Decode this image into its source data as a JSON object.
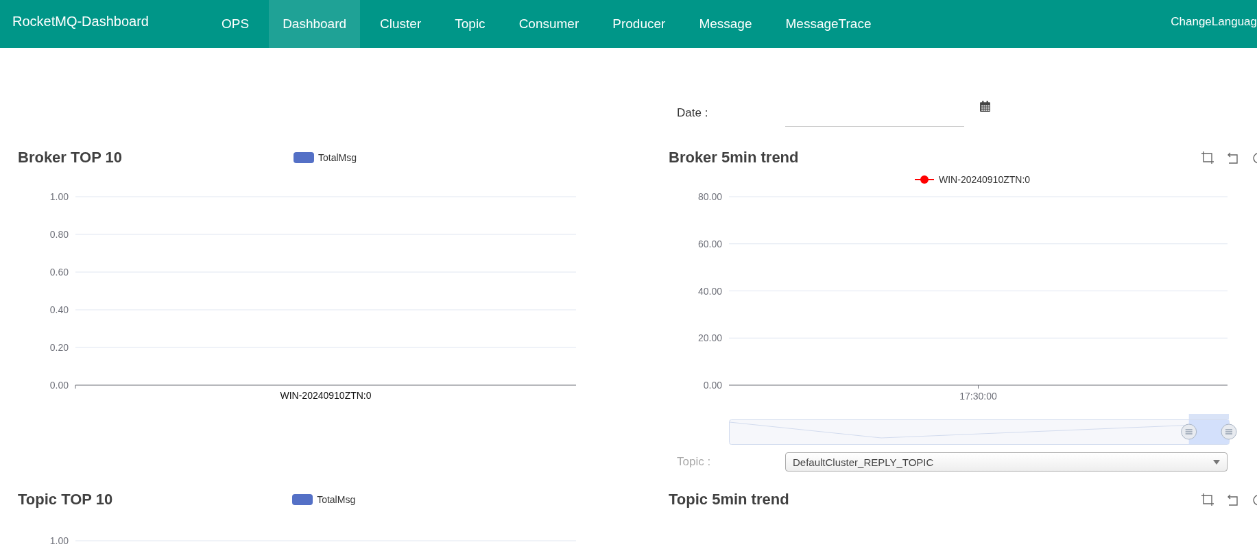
{
  "navbar": {
    "brand": "RocketMQ-Dashboard",
    "items": [
      {
        "label": "OPS",
        "selected": false
      },
      {
        "label": "Dashboard",
        "selected": true
      },
      {
        "label": "Cluster",
        "selected": false
      },
      {
        "label": "Topic",
        "selected": false
      },
      {
        "label": "Consumer",
        "selected": false
      },
      {
        "label": "Producer",
        "selected": false
      },
      {
        "label": "Message",
        "selected": false
      },
      {
        "label": "MessageTrace",
        "selected": false
      }
    ],
    "language": "ChangeLanguag"
  },
  "date_filter": {
    "label": "Date :"
  },
  "broker_top10": {
    "title": "Broker TOP 10",
    "chart_data": {
      "type": "bar",
      "categories": [
        "WIN-20240910ZTN:0"
      ],
      "series": [
        {
          "name": "TotalMsg",
          "color": "#5470c6",
          "values": [
            0
          ]
        }
      ],
      "ylim": [
        0,
        1
      ],
      "grid": true,
      "yticks": [
        {
          "value": 0,
          "label": "0.00"
        },
        {
          "value": 0.2,
          "label": "0.20"
        },
        {
          "value": 0.4,
          "label": "0.40"
        },
        {
          "value": 0.6,
          "label": "0.60"
        },
        {
          "value": 0.8,
          "label": "0.80"
        },
        {
          "value": 1,
          "label": "1.00"
        }
      ]
    }
  },
  "broker_trend": {
    "title": "Broker 5min trend",
    "zoom_slider": {
      "level": 0.08
    },
    "chart_data": {
      "type": "line",
      "x": [
        "17:30:00"
      ],
      "series": [
        {
          "name": "WIN-20240910ZTN:0",
          "color": "#ff0000",
          "values": [
            null
          ]
        }
      ],
      "ylim": [
        0,
        80
      ],
      "grid": true,
      "yticks": [
        {
          "value": 0,
          "label": "0.00"
        },
        {
          "value": 20,
          "label": "20.00"
        },
        {
          "value": 40,
          "label": "40.00"
        },
        {
          "value": 60,
          "label": "60.00"
        },
        {
          "value": 80,
          "label": "80.00"
        }
      ]
    }
  },
  "topic_filter": {
    "label": "Topic :",
    "value": "DefaultCluster_REPLY_TOPIC"
  },
  "topic_top10": {
    "title": "Topic TOP 10",
    "legend": "TotalMsg",
    "axis_labels": [
      "1.00"
    ]
  },
  "topic_trend": {
    "title": "Topic 5min trend"
  }
}
